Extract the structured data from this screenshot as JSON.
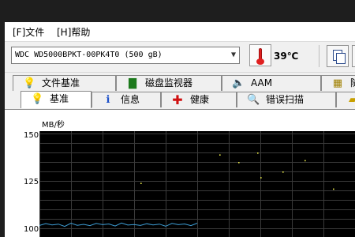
{
  "menu": {
    "file": "[F]文件",
    "help": "[H]帮助"
  },
  "toolbar": {
    "drive_select": "WDC WD5000BPKT-00PK4T0 (500 gB)",
    "temperature": "39℃",
    "thermometer_icon": "thermometer-icon",
    "copy_icon": "copy-icon"
  },
  "tabs_row1": [
    {
      "label": "文件基准",
      "icon": "info-bulb-icon"
    },
    {
      "label": "磁盘监视器",
      "icon": "bar-chart-icon"
    },
    {
      "label": "AAM",
      "icon": "speaker-icon"
    },
    {
      "label": "随",
      "icon": "random-icon"
    }
  ],
  "tabs_row2": [
    {
      "label": "基准",
      "icon": "bulb-icon",
      "active": true
    },
    {
      "label": "信息",
      "icon": "info-icon"
    },
    {
      "label": "健康",
      "icon": "red-cross-icon"
    },
    {
      "label": "错误扫描",
      "icon": "magnifier-icon"
    },
    {
      "label": "",
      "icon": "folder-icon"
    }
  ],
  "chart_data": {
    "type": "line",
    "ylabel": "MB/秒",
    "y_ticks": [
      "150",
      "125",
      "100"
    ],
    "ylim": [
      100,
      150
    ],
    "grid": true,
    "colors": {
      "background": "#000000",
      "grid": "#3a3a3a",
      "line": "#3ea0d8",
      "points": "#e8e84a"
    },
    "series": [
      {
        "values": [
          101.5,
          102.5,
          101.8,
          102.2,
          101.0,
          102.7,
          101.6,
          102.1,
          101.4,
          102.6,
          101.9,
          102.3,
          101.2,
          102.8,
          101.7,
          102.0,
          101.5,
          102.4,
          101.8,
          102.2,
          101.1,
          102.6,
          101.9,
          102.3,
          101.4,
          102.7
        ]
      }
    ],
    "points": [
      {
        "x": 0.57,
        "y": 139
      },
      {
        "x": 0.63,
        "y": 135
      },
      {
        "x": 0.69,
        "y": 140
      },
      {
        "x": 0.7,
        "y": 127
      },
      {
        "x": 0.84,
        "y": 136
      },
      {
        "x": 0.93,
        "y": 121
      },
      {
        "x": 0.32,
        "y": 124
      },
      {
        "x": 0.77,
        "y": 130
      }
    ]
  }
}
